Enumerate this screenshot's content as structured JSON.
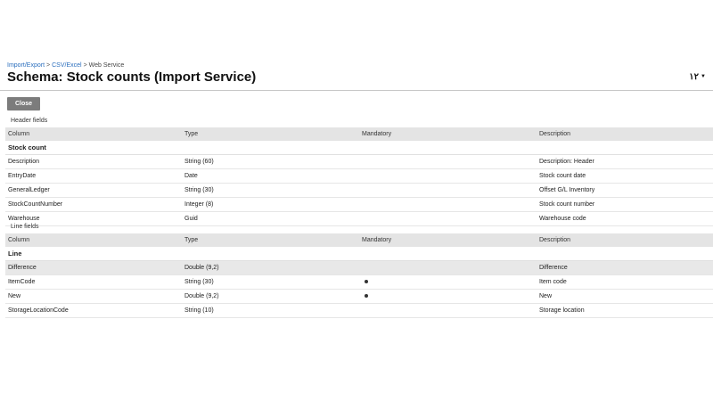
{
  "breadcrumb": {
    "items": [
      "Import/Export",
      "CSV/Excel"
    ],
    "current": "Web Service",
    "separator": ">"
  },
  "page_title": "Schema: Stock counts (Import Service)",
  "lang_menu": {
    "label": "۱۲",
    "caret": "▼"
  },
  "close_button": "Close",
  "columns": {
    "column": "Column",
    "type": "Type",
    "mandatory": "Mandatory",
    "description": "Description"
  },
  "header_section": {
    "label": "Header fields",
    "group": "Stock count",
    "rows": [
      {
        "column": "Description",
        "type": "String (60)",
        "mandatory": false,
        "description": "Description: Header"
      },
      {
        "column": "EntryDate",
        "type": "Date",
        "mandatory": false,
        "description": "Stock count date"
      },
      {
        "column": "GeneralLedger",
        "type": "String (30)",
        "mandatory": false,
        "description": "Offset G/L Inventory"
      },
      {
        "column": "StockCountNumber",
        "type": "Integer (8)",
        "mandatory": false,
        "description": "Stock count number"
      },
      {
        "column": "Warehouse",
        "type": "Guid",
        "mandatory": false,
        "description": "Warehouse code"
      }
    ]
  },
  "line_section": {
    "label": "Line fields",
    "group": "Line",
    "rows": [
      {
        "column": "Difference",
        "type": "Double (9,2)",
        "mandatory": false,
        "description": "Difference"
      },
      {
        "column": "ItemCode",
        "type": "String (30)",
        "mandatory": true,
        "description": "Item code"
      },
      {
        "column": "New",
        "type": "Double (9,2)",
        "mandatory": true,
        "description": "New"
      },
      {
        "column": "StorageLocationCode",
        "type": "String (10)",
        "mandatory": false,
        "description": "Storage location"
      }
    ]
  }
}
